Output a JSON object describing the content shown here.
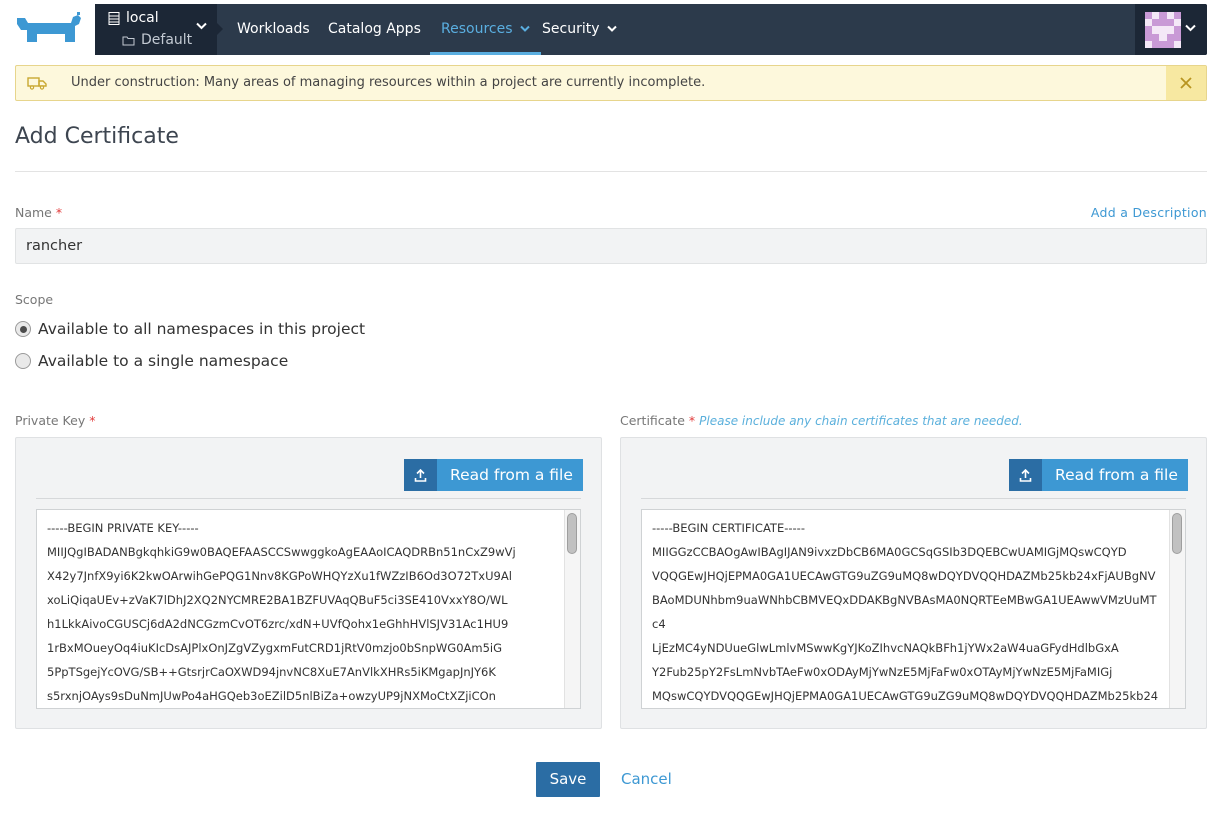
{
  "nav": {
    "cluster": "local",
    "project": "Default",
    "links": [
      "Workloads",
      "Catalog Apps",
      "Resources",
      "Security"
    ],
    "active_link": "Resources"
  },
  "banner": {
    "text": "Under construction: Many areas of managing resources within a project are currently incomplete."
  },
  "page": {
    "title": "Add Certificate"
  },
  "form": {
    "name_label": "Name",
    "required_mark": "*",
    "add_description": "Add a Description",
    "name_value": "rancher",
    "scope_label": "Scope",
    "scope_options": [
      {
        "label": "Available to all namespaces in this project",
        "selected": true
      },
      {
        "label": "Available to a single namespace",
        "selected": false
      }
    ]
  },
  "private_key": {
    "label": "Private Key",
    "read_button": "Read from a file",
    "lines": [
      "-----BEGIN PRIVATE KEY-----",
      "MIIJQgIBADANBgkqhkiG9w0BAQEFAASCCSwwggkoAgEAAoICAQDRBn51nCxZ9wVj",
      "X42y7JnfX9yi6K2kwOArwihGePQG1Nnv8KGPoWHQYzXu1fWZzIB6Od3O72TxU9Al",
      "xoLiQiqaUEv+zVaK7lDhJ2XQ2NYCMRE2BA1BZFUVAqQBuF5ci3SE410VxxY8O/WL",
      "h1LkkAivoCGUSCj6dA2dNCGzmCvOT6zrc/xdN+UVfQohx1eGhhHVlSJV31Ac1HU9",
      "1rBxMOueyOq4iuKIcDsAJPlxOnJZgVZygxmFutCRD1jRtV0mzjo0bSnpWG0Am5iG",
      "5PpTSgejYcOVG/SB++GtsrjrCaOXWD94jnvNC8XuE7AnVlkXHRs5iKMgapJnJY6K",
      "s5rxnjOAys9sDuNmJUwPo4aHGQeb3oEZilD5nlBiZa+owzyUP9jNXMoCtXZjiCOn"
    ]
  },
  "certificate": {
    "label": "Certificate",
    "hint": "Please include any chain certificates that are needed.",
    "read_button": "Read from a file",
    "lines": [
      "-----BEGIN CERTIFICATE-----",
      "MIIGGzCCBAOgAwIBAgIJAN9ivxzDbCB6MA0GCSqGSIb3DQEBCwUAMIGjMQswCQYD",
      "VQQGEwJHQjEPMA0GA1UECAwGTG9uZG9uMQ8wDQYDVQQHDAZMb25kb24xFjAUBgNV",
      "BAoMDUNhbm9uaWNhbCBMVEQxDDAKBgNVBAsMA0NQRTEeMBwGA1UEAwwVMzUuMT",
      "c4",
      "LjEzMC4yNDUueGlwLmlvMSwwKgYJKoZIhvcNAQkBFh1jYWx2aW4uaGFydHdlbGxA",
      "Y2Fub25pY2FsLmNvbTAeFw0xODAyMjYwNzE5MjFaFw0xOTAyMjYwNzE5MjFaMIGj",
      "MQswCQYDVQQGEwJHQjEPMA0GA1UECAwGTG9uZG9uMQ8wDQYDVQQHDAZMb25kb24"
    ]
  },
  "footer": {
    "save": "Save",
    "cancel": "Cancel"
  },
  "colors": {
    "nav_bg": "#2c3a4b",
    "nav_dark": "#1c2736",
    "accent": "#3d98d3",
    "primary_button": "#2b6da4",
    "logo": "#3d98d3",
    "banner_bg": "#fdf8dc"
  },
  "icons": {
    "logo": "rancher-logo",
    "banner": "truck-icon",
    "close": "close-icon",
    "upload": "upload-icon"
  }
}
